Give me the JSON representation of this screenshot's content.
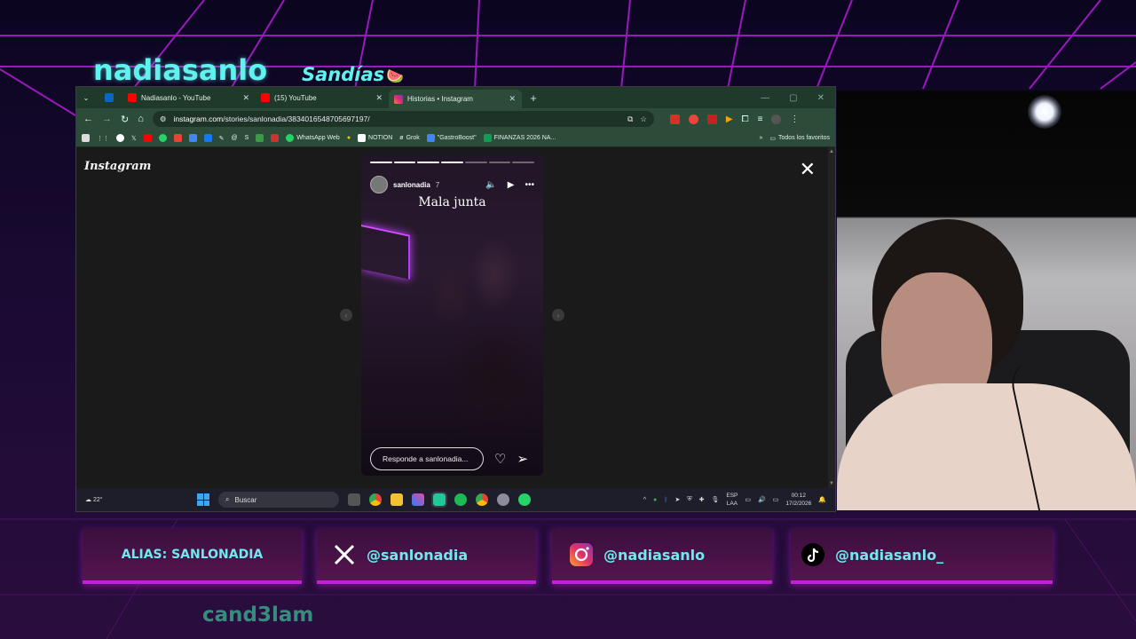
{
  "overlay": {
    "streamer_name": "nadiasanlo",
    "community_name": "Sandías",
    "watermelon_emoji": "🍉",
    "footer_handle": "cand3lam",
    "social": {
      "alias": "ALIAS: SANLONADIA",
      "x_handle": "@sanlonadia",
      "instagram_handle": "@nadiasanlo",
      "tiktok_handle": "@nadiasanlo_"
    },
    "accent_color": "#c21fd6",
    "text_color": "#6fe9f0"
  },
  "browser": {
    "tabs": [
      {
        "label": "Nadiasanlo - YouTube",
        "icon": "youtube-icon"
      },
      {
        "label": "(15) YouTube",
        "icon": "youtube-icon"
      },
      {
        "label": "Historias • Instagram",
        "icon": "instagram-icon",
        "active": true
      }
    ],
    "url_host": "instagram.com",
    "url_path": "/stories/sanlonadia/3834016548705697197/",
    "bookmarks": [
      {
        "label": "WhatsApp Web"
      },
      {
        "label": "NOTION"
      },
      {
        "label": "Grok"
      },
      {
        "label": "\"GastroBoost\""
      },
      {
        "label": "FINANZAS 2026 NA..."
      }
    ],
    "bookmarks_folder": "Todos los favoritos",
    "overflow_chevron": "»"
  },
  "instagram": {
    "logo": "Instagram",
    "story": {
      "username": "sanlonadia",
      "time": "7",
      "caption": "Mala junta",
      "progress_done": 4,
      "progress_total": 7
    },
    "reply_placeholder": "Responde a sanlonadia..."
  },
  "taskbar": {
    "temperature": "22°",
    "search_label": "Buscar",
    "lang_line1": "ESP",
    "lang_line2": "LAA",
    "time": "00:12",
    "date": "17/2/2026"
  }
}
